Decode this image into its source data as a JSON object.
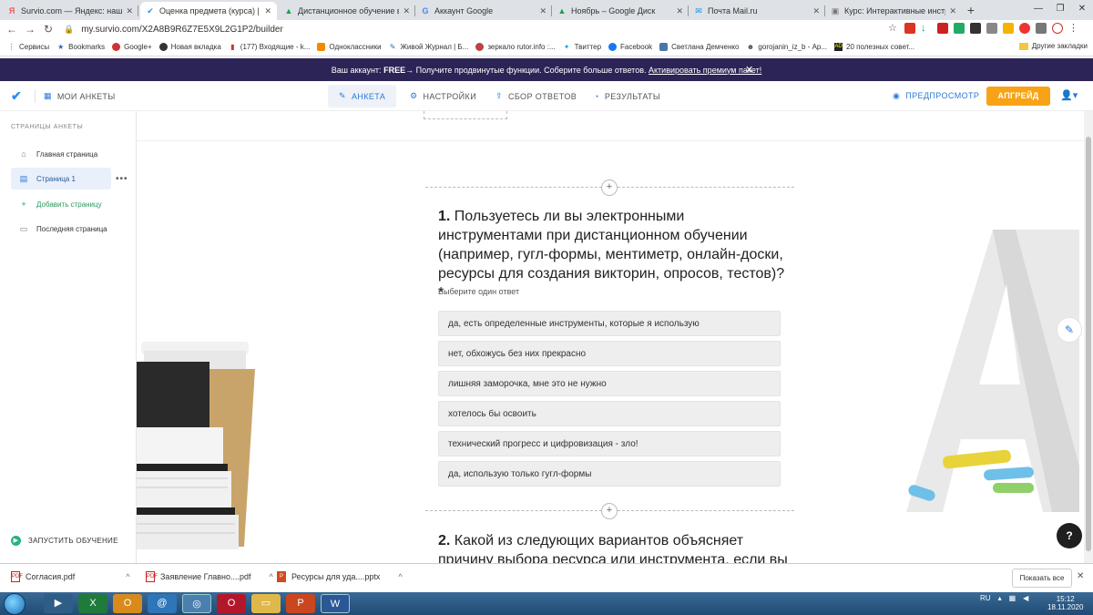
{
  "browser": {
    "tabs": [
      {
        "title": "Survio.com — Яндекс: нашлось",
        "icon": "yandex-icon"
      },
      {
        "title": "Оценка предмета (курса) | Survio",
        "icon": "survio-icon"
      },
      {
        "title": "Дистанционное обучение в Ак...",
        "icon": "drive-icon"
      },
      {
        "title": "Аккаунт Google",
        "icon": "google-icon"
      },
      {
        "title": "Ноябрь – Google Диск",
        "icon": "drive-icon"
      },
      {
        "title": "Почта Mail.ru",
        "icon": "mail-icon"
      },
      {
        "title": "Курс: Интерактивные инструме",
        "icon": "course-icon"
      }
    ],
    "url": "my.survio.com/X2A8B9R6Z7E5X9L2G1P2/builder",
    "bookmarks": [
      "Сервисы",
      "Bookmarks",
      "Google+",
      "Новая вкладка",
      "(177) Входящие - k...",
      "Одноклассники",
      "Живой Журнал | Б...",
      "зеркало rutor.info :...",
      "Твиттер",
      "Facebook",
      "Светлана Демченко",
      "gorojanin_iz_b - Ар...",
      "20 полезных совет..."
    ],
    "other_bookmarks": "Другие закладки"
  },
  "banner": {
    "prefix": "Ваш аккаунт: ",
    "plan": "FREE",
    "middle": " → Получите продвинутые функции. Соберите больше ответов. ",
    "link": "Активировать премиум пакет!"
  },
  "header": {
    "my_forms": "МОИ АНКЕТЫ",
    "tabs": [
      {
        "label": "АНКЕТА",
        "icon": "pencil-icon"
      },
      {
        "label": "НАСТРОЙКИ",
        "icon": "gear-icon"
      },
      {
        "label": "СБОР ОТВЕТОВ",
        "icon": "share-icon"
      },
      {
        "label": "РЕЗУЛЬТАТЫ",
        "icon": "chart-icon"
      }
    ],
    "preview": "ПРЕДПРОСМОТР",
    "upgrade": "АПГРЕЙД"
  },
  "sidebar": {
    "heading": "СТРАНИЦЫ АНКЕТЫ",
    "items": [
      {
        "label": "Главная страница",
        "icon": "home-icon"
      },
      {
        "label": "Страница 1",
        "icon": "page-icon"
      },
      {
        "label": "Добавить страницу",
        "icon": "plus-icon"
      },
      {
        "label": "Последняя страница",
        "icon": "flag-icon"
      }
    ],
    "start_training": "ЗАПУСТИТЬ ОБУЧЕНИЕ"
  },
  "question1": {
    "number": "1.",
    "text": " Пользуетесь ли вы электронными инструментами при дистанционном обучении (например, гугл-формы, ментиметр, онлайн-доски, ресурсы для создания викторин, опросов, тестов)?*",
    "hint": "Выберите один ответ",
    "options": [
      "да, есть определенные инструменты, которые я использую",
      "нет, обхожусь без них прекрасно",
      "лишняя заморочка, мне это не нужно",
      "хотелось бы освоить",
      "технический прогресс и цифровизация - зло!",
      "да, использую только гугл-формы"
    ]
  },
  "question2": {
    "number": "2.",
    "text": " Какой из следующих вариантов объясняет причину выбора ресурса или инструмента, если вы"
  },
  "help_label": "?",
  "downloads": {
    "files": [
      "Согласия.pdf",
      "Заявление Главно....pdf",
      "Ресурсы для уда....pptx"
    ],
    "show_all": "Показать все"
  },
  "taskbar": {
    "lang": "RU",
    "time": "15:12",
    "date": "18.11.2020"
  }
}
